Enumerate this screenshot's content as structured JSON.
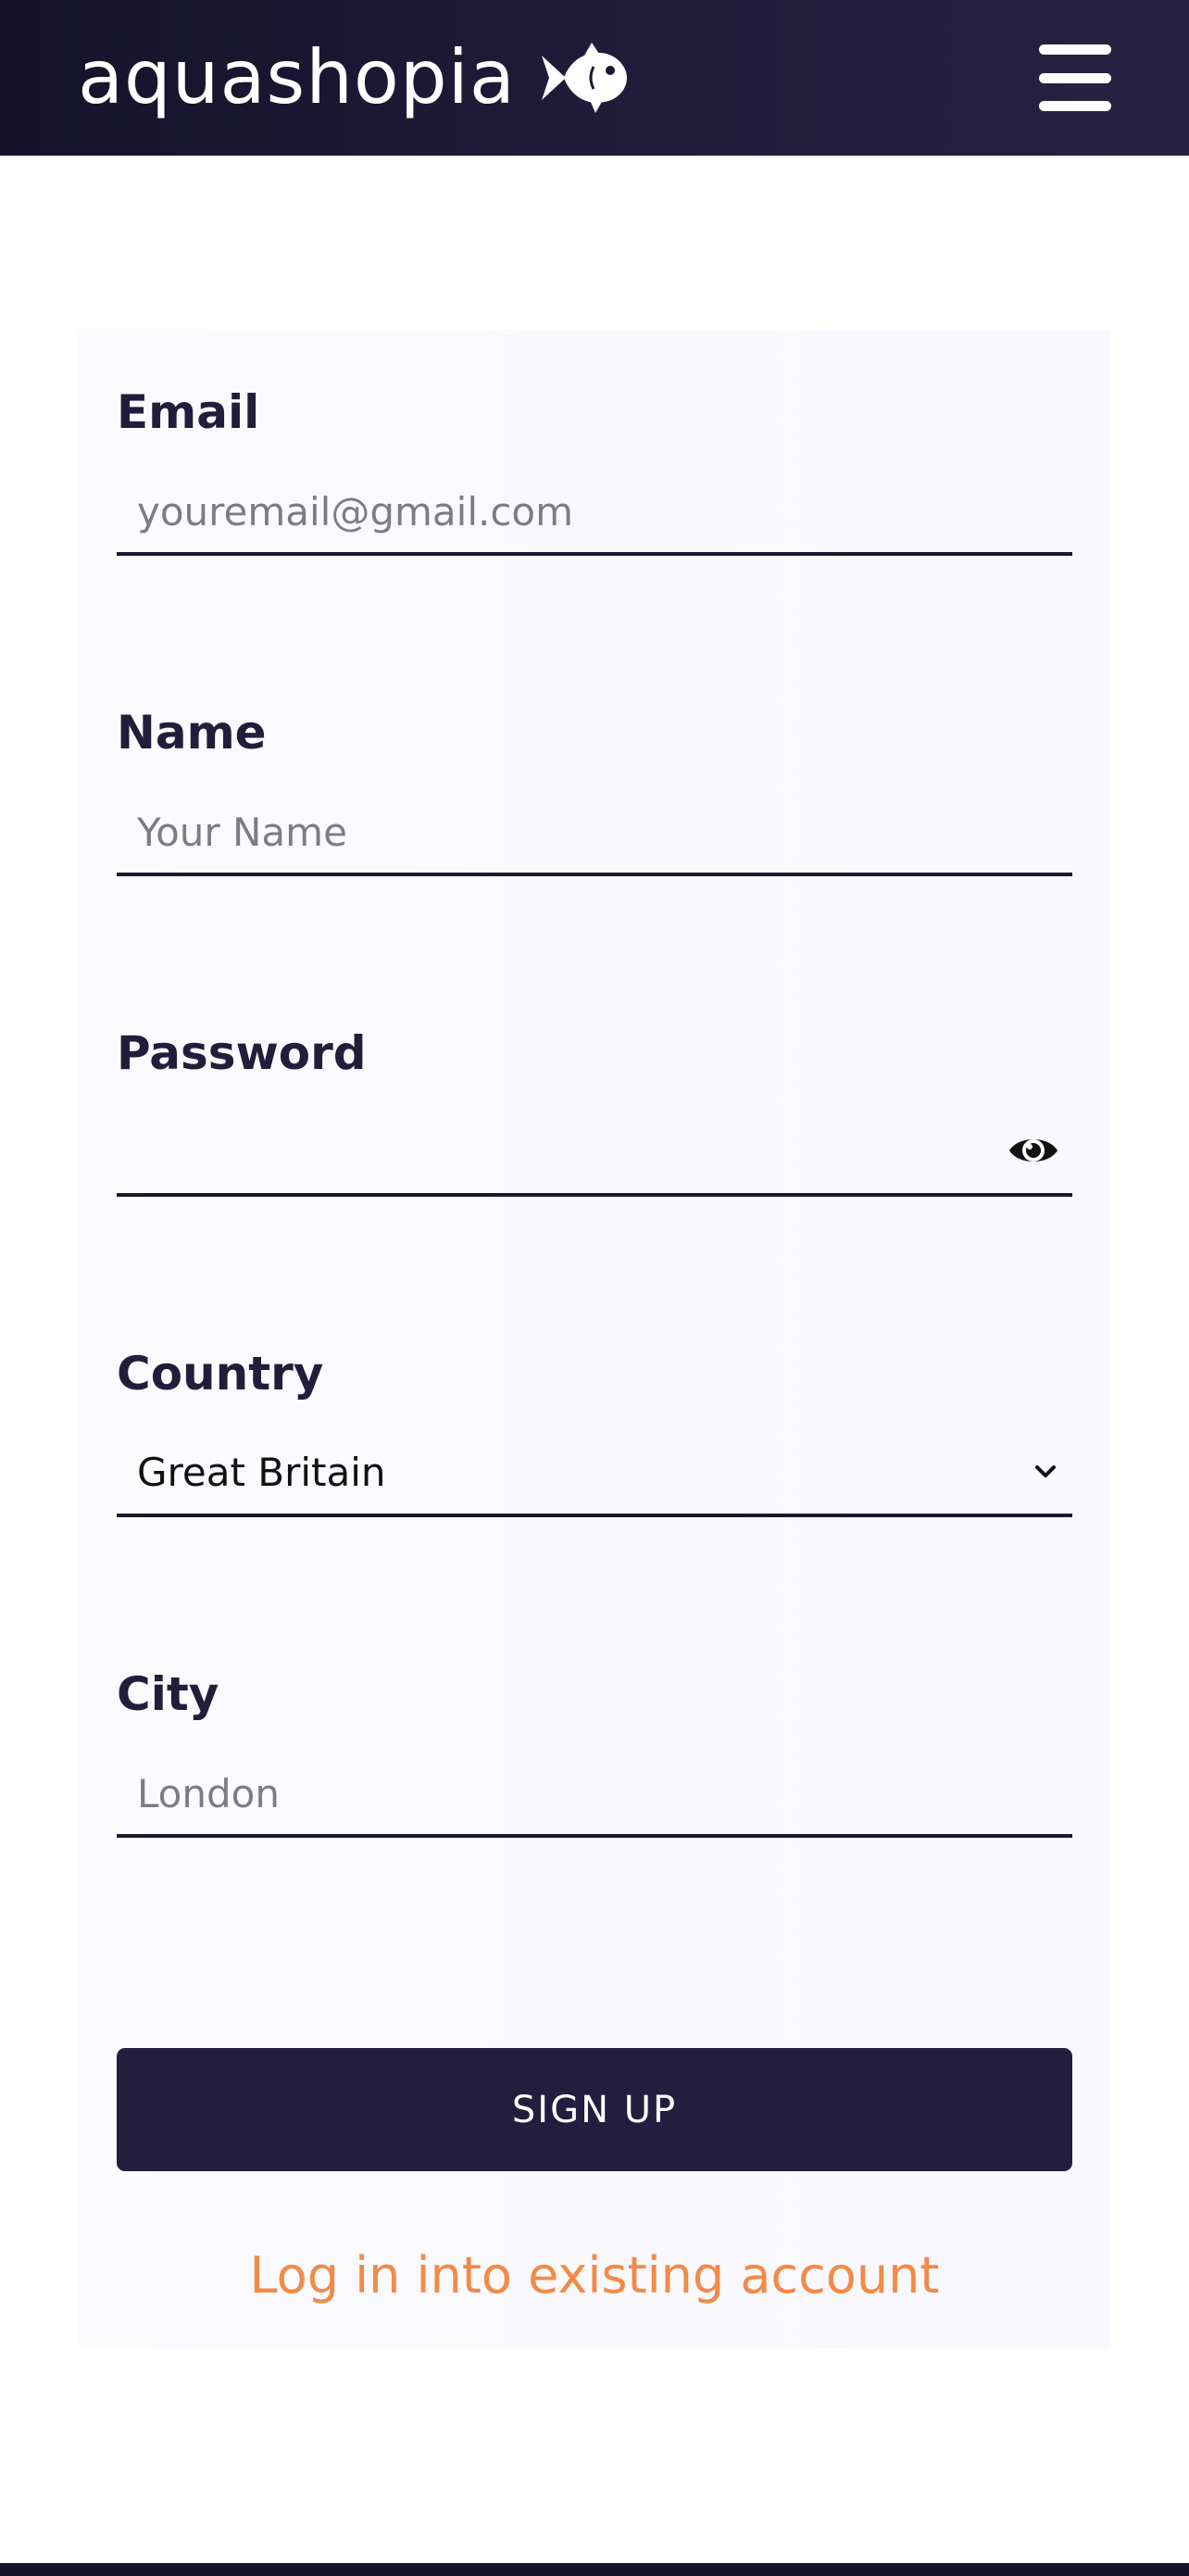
{
  "header": {
    "brand": "aquashopia",
    "brand_icon": "fish-icon",
    "menu_icon": "hamburger-menu-icon"
  },
  "form": {
    "email": {
      "label": "Email",
      "placeholder": "youremail@gmail.com",
      "value": ""
    },
    "name": {
      "label": "Name",
      "placeholder": "Your Name",
      "value": ""
    },
    "password": {
      "label": "Password",
      "value": "",
      "toggle_icon": "eye-icon"
    },
    "country": {
      "label": "Country",
      "selected": "Great Britain",
      "dropdown_icon": "chevron-down-icon"
    },
    "city": {
      "label": "City",
      "placeholder": "London",
      "value": ""
    }
  },
  "actions": {
    "signup_label": "SIGN UP",
    "login_link": "Log in into existing account"
  },
  "colors": {
    "header_bg": "#1a1630",
    "primary_button": "#241e3e",
    "link": "#f38a47",
    "label": "#221d3b"
  }
}
